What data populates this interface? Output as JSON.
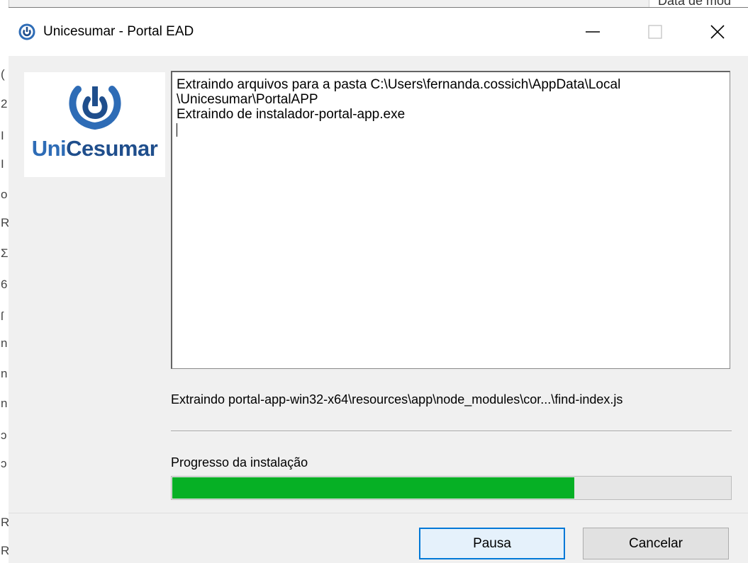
{
  "background_app": {
    "top_fragment": "Data de mod",
    "side_fragments": [
      "(",
      "2",
      "I",
      "I",
      "o",
      "R",
      "Σ",
      "6",
      "ſ",
      "n",
      "n",
      "n",
      "ɔ",
      "ɔ",
      "R",
      "R"
    ]
  },
  "window": {
    "title": "Unicesumar - Portal EAD",
    "controls": {
      "minimize_icon": "minimize-icon",
      "maximize_icon": "maximize-icon",
      "close_icon": "close-icon"
    }
  },
  "logo": {
    "text_part1": "Uni",
    "text_part2": "Cesumar",
    "colors": {
      "light_blue": "#2e6cb6",
      "dark_blue": "#1f4e8c"
    }
  },
  "log": {
    "lines": [
      "Extraindo arquivos para a pasta C:\\Users\\fernanda.cossich\\AppData\\Local",
      "\\Unicesumar\\PortalAPP",
      "Extraindo de instalador-portal-app.exe"
    ]
  },
  "status": {
    "current_file": "Extraindo portal-app-win32-x64\\resources\\app\\node_modules\\cor...\\find-index.js"
  },
  "progress": {
    "label": "Progresso da instalação",
    "fraction": 0.72,
    "color": "#06b025"
  },
  "buttons": {
    "pause_label": "Pausa",
    "cancel_label": "Cancelar",
    "accent": "#0078d7"
  }
}
